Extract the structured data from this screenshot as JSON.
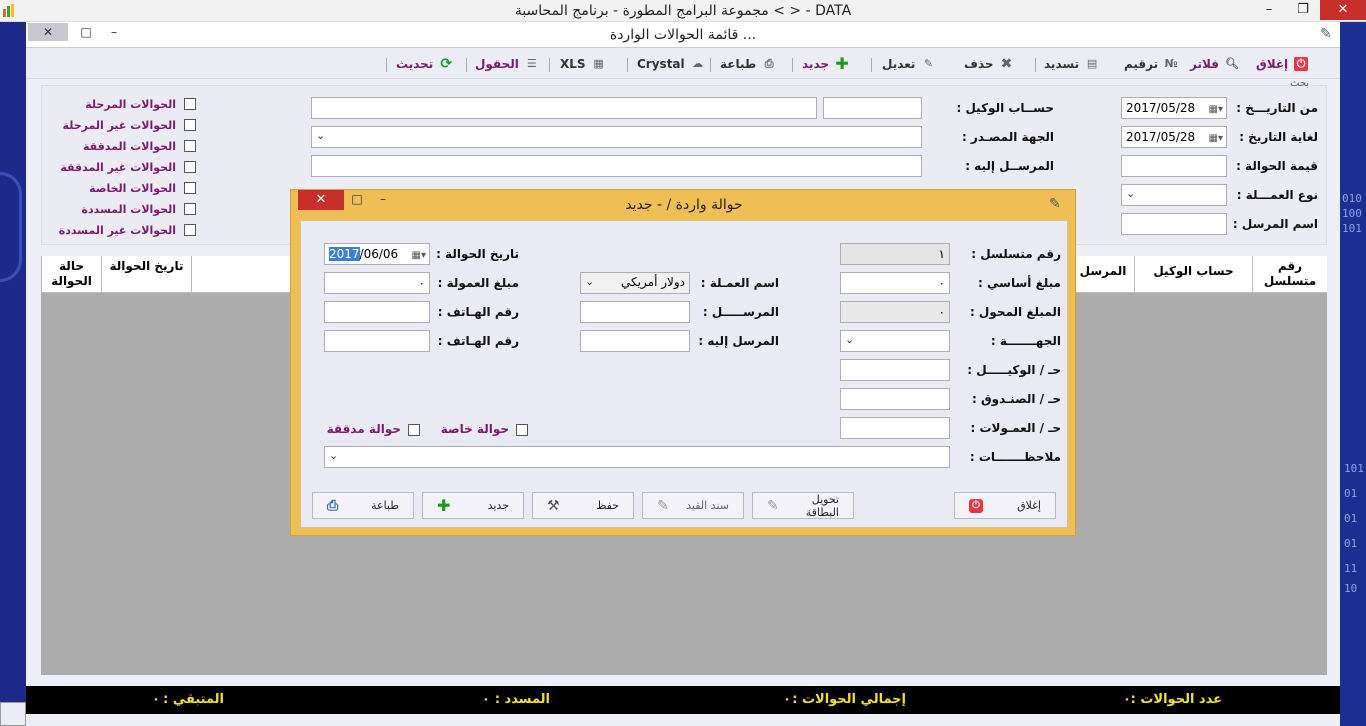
{
  "window": {
    "title": "مجموعة البرامج المطورة - برنامج المحاسبة <  > - DATA",
    "minimize": "–",
    "restore": "❐",
    "close": "✕"
  },
  "form": {
    "title": "قائمة الحوالات الواردة ...",
    "close": "✕",
    "restore": "□",
    "minimize": "–"
  },
  "toolbar": {
    "close": "إغلاق",
    "filters": "فلاتر",
    "number": "ترقيم",
    "pay": "تسديد",
    "delete": "حذف",
    "edit": "تعديل",
    "new": "جديد",
    "print": "طباعة",
    "crystal": "Crystal",
    "xls": "XLS",
    "fields": "الحقول",
    "refresh": "تحديث"
  },
  "search": {
    "caption": "بحث",
    "from_date_label": "من التاريـــخ :",
    "from_date": "2017/05/28",
    "to_date_label": "لغاية التاريخ :",
    "to_date": "2017/05/28",
    "amount_label": "قيمة الحوالة :",
    "currency_label": "نوع العمـــلة :",
    "sender_label": "اسم المرسل :",
    "agent_label": "حســاب الوكيل :",
    "source_label": "الجهة المصـدر :",
    "recipient_label": "المرســل إليه :"
  },
  "filters": [
    "الحوالات المرحلة",
    "الحوالات غير المرحلة",
    "الحوالات المدققة",
    "الحوالات غير المدققة",
    "الحوالات الخاصة",
    "الحوالات المسددة",
    "الحوالات غير المسددة"
  ],
  "grid": {
    "col_serial": "رقم متسلسل",
    "col_agent": "حساب الوكيل",
    "col_sender": "المرسل",
    "col_date": "تاريخ الحوالة",
    "col_status": "حالة الحوالة"
  },
  "status": {
    "count": "عدد الحوالات :",
    "count_val": "٠",
    "total": "إجمالي الحوالات :",
    "total_val": "٠",
    "paid": "المسدد :",
    "paid_val": "٠",
    "remaining": "المتبقي :",
    "remaining_val": "٠"
  },
  "dialog": {
    "title": "حوالة واردة /  - جديد",
    "serial_label": "رقم متسلسل :",
    "serial": "١",
    "base_amount_label": "مبلغ أساسي :",
    "base_amount": "٠",
    "transferred_label": "المبلغ المحول :",
    "transferred": "٠",
    "party_label": "الجهـــــــة :",
    "agent_label": "حـ / الوكيـــــل :",
    "fund_label": "حـ / الصنـدوق :",
    "commissions_label": "حـ / العمـولات :",
    "notes_label": "ملاحظـــــــات :",
    "currency_label": "اسم العمـلة :",
    "currency": "دولار أمريكي",
    "sender_label": "المرســـــل :",
    "recipient_label": "المرسل إليه :",
    "date_label": "تاريخ الحوالة :",
    "date_sel": "2017",
    "date_rest": "/06/06",
    "commission_label": "مبلغ العمولة :",
    "commission": "٠",
    "phone_label": "رقم الهـاتف :",
    "phone2_label": "رقم الهـاتف :",
    "special_label": "حوالة خاصة",
    "audited_label": "حوالة مدققة",
    "btn_close": "إغلاق",
    "btn_card": "تحويل البطاقة",
    "btn_entry": "سند القيد",
    "btn_save": "حفظ",
    "btn_new": "جديد",
    "btn_print": "طباعة"
  }
}
